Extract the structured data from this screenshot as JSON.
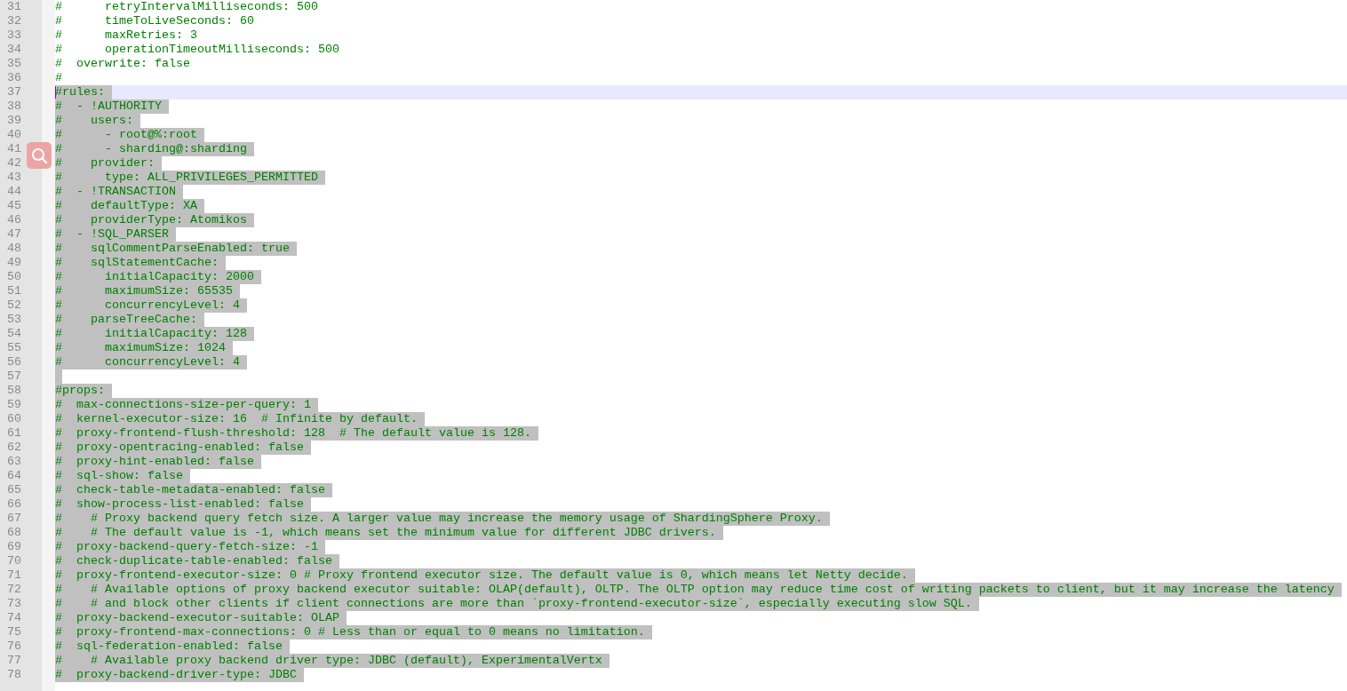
{
  "editor": {
    "lines": [
      {
        "number": "31",
        "text": "#      retryIntervalMilliseconds: 500",
        "selected": false,
        "current": false
      },
      {
        "number": "32",
        "text": "#      timeToLiveSeconds: 60",
        "selected": false,
        "current": false
      },
      {
        "number": "33",
        "text": "#      maxRetries: 3",
        "selected": false,
        "current": false
      },
      {
        "number": "34",
        "text": "#      operationTimeoutMilliseconds: 500",
        "selected": false,
        "current": false
      },
      {
        "number": "35",
        "text": "#  overwrite: false",
        "selected": false,
        "current": false
      },
      {
        "number": "36",
        "text": "#",
        "selected": false,
        "current": false
      },
      {
        "number": "37",
        "text": "#rules:",
        "selected": true,
        "current": true
      },
      {
        "number": "38",
        "text": "#  - !AUTHORITY",
        "selected": true,
        "current": false
      },
      {
        "number": "39",
        "text": "#    users:",
        "selected": true,
        "current": false
      },
      {
        "number": "40",
        "text": "#      - root@%:root",
        "selected": true,
        "current": false
      },
      {
        "number": "41",
        "text": "#      - sharding@:sharding",
        "selected": true,
        "current": false
      },
      {
        "number": "42",
        "text": "#    provider:",
        "selected": true,
        "current": false
      },
      {
        "number": "43",
        "text": "#      type: ALL_PRIVILEGES_PERMITTED",
        "selected": true,
        "current": false
      },
      {
        "number": "44",
        "text": "#  - !TRANSACTION",
        "selected": true,
        "current": false
      },
      {
        "number": "45",
        "text": "#    defaultType: XA",
        "selected": true,
        "current": false
      },
      {
        "number": "46",
        "text": "#    providerType: Atomikos",
        "selected": true,
        "current": false
      },
      {
        "number": "47",
        "text": "#  - !SQL_PARSER",
        "selected": true,
        "current": false
      },
      {
        "number": "48",
        "text": "#    sqlCommentParseEnabled: true",
        "selected": true,
        "current": false
      },
      {
        "number": "49",
        "text": "#    sqlStatementCache:",
        "selected": true,
        "current": false
      },
      {
        "number": "50",
        "text": "#      initialCapacity: 2000",
        "selected": true,
        "current": false
      },
      {
        "number": "51",
        "text": "#      maximumSize: 65535",
        "selected": true,
        "current": false
      },
      {
        "number": "52",
        "text": "#      concurrencyLevel: 4",
        "selected": true,
        "current": false
      },
      {
        "number": "53",
        "text": "#    parseTreeCache:",
        "selected": true,
        "current": false
      },
      {
        "number": "54",
        "text": "#      initialCapacity: 128",
        "selected": true,
        "current": false
      },
      {
        "number": "55",
        "text": "#      maximumSize: 1024",
        "selected": true,
        "current": false
      },
      {
        "number": "56",
        "text": "#      concurrencyLevel: 4",
        "selected": true,
        "current": false
      },
      {
        "number": "57",
        "selected": true,
        "current": false
      },
      {
        "number": "58",
        "text": "#props:",
        "selected": true,
        "current": false
      },
      {
        "number": "59",
        "text": "#  max-connections-size-per-query: 1",
        "selected": true,
        "current": false
      },
      {
        "number": "60",
        "text": "#  kernel-executor-size: 16  # Infinite by default.",
        "selected": true,
        "current": false
      },
      {
        "number": "61",
        "text": "#  proxy-frontend-flush-threshold: 128  # The default value is 128.",
        "selected": true,
        "current": false
      },
      {
        "number": "62",
        "text": "#  proxy-opentracing-enabled: false",
        "selected": true,
        "current": false
      },
      {
        "number": "63",
        "text": "#  proxy-hint-enabled: false",
        "selected": true,
        "current": false
      },
      {
        "number": "64",
        "text": "#  sql-show: false",
        "selected": true,
        "current": false
      },
      {
        "number": "65",
        "text": "#  check-table-metadata-enabled: false",
        "selected": true,
        "current": false
      },
      {
        "number": "66",
        "text": "#  show-process-list-enabled: false",
        "selected": true,
        "current": false
      },
      {
        "number": "67",
        "text": "#    # Proxy backend query fetch size. A larger value may increase the memory usage of ShardingSphere Proxy.",
        "selected": true,
        "current": false
      },
      {
        "number": "68",
        "text": "#    # The default value is -1, which means set the minimum value for different JDBC drivers.",
        "selected": true,
        "current": false
      },
      {
        "number": "69",
        "text": "#  proxy-backend-query-fetch-size: -1",
        "selected": true,
        "current": false
      },
      {
        "number": "70",
        "text": "#  check-duplicate-table-enabled: false",
        "selected": true,
        "current": false
      },
      {
        "number": "71",
        "text": "#  proxy-frontend-executor-size: 0 # Proxy frontend executor size. The default value is 0, which means let Netty decide.",
        "selected": true,
        "current": false
      },
      {
        "number": "72",
        "text": "#    # Available options of proxy backend executor suitable: OLAP(default), OLTP. The OLTP option may reduce time cost of writing packets to client, but it may increase the latency",
        "selected": true,
        "current": false
      },
      {
        "number": "73",
        "text": "#    # and block other clients if client connections are more than `proxy-frontend-executor-size`, especially executing slow SQL.",
        "selected": true,
        "current": false
      },
      {
        "number": "74",
        "text": "#  proxy-backend-executor-suitable: OLAP",
        "selected": true,
        "current": false
      },
      {
        "number": "75",
        "text": "#  proxy-frontend-max-connections: 0 # Less than or equal to 0 means no limitation.",
        "selected": true,
        "current": false
      },
      {
        "number": "76",
        "text": "#  sql-federation-enabled: false",
        "selected": true,
        "current": false
      },
      {
        "number": "77",
        "text": "#    # Available proxy backend driver type: JDBC (default), ExperimentalVertx",
        "selected": true,
        "current": false
      },
      {
        "number": "78",
        "text": "#  proxy-backend-driver-type: JDBC",
        "selected": true,
        "current": false
      }
    ]
  }
}
